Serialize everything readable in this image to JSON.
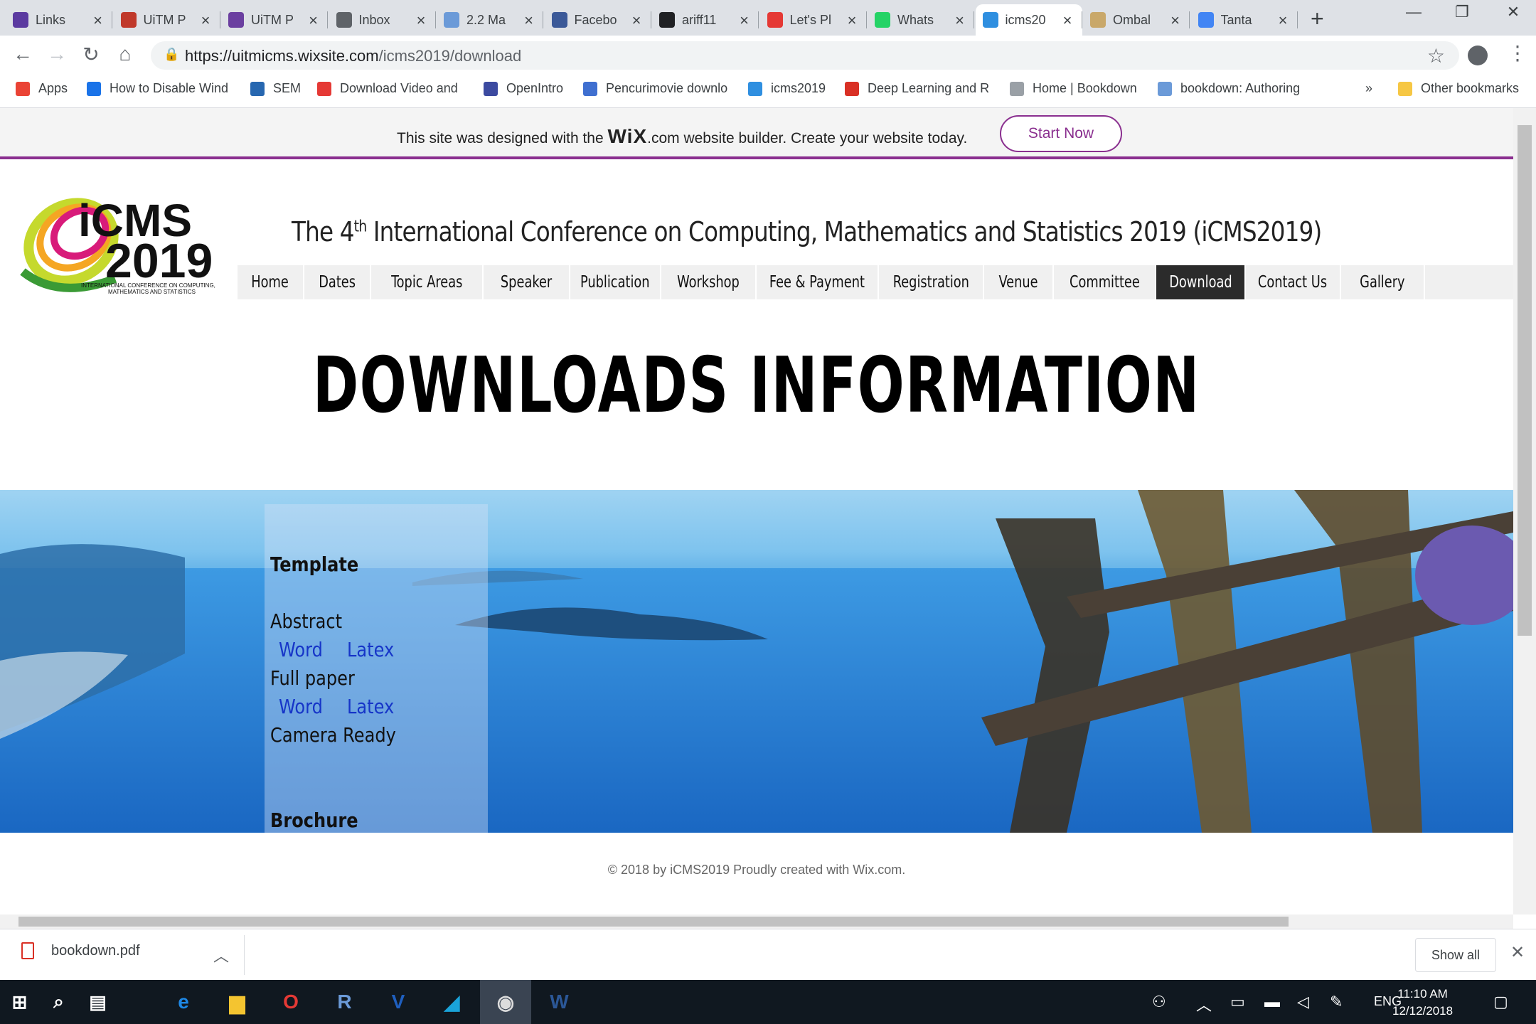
{
  "tabs": [
    {
      "title": "Links",
      "icon": "shield-icon",
      "color": "#5b3aa0"
    },
    {
      "title": "UiTM P",
      "icon": "uitm-icon",
      "color": "#c0392b"
    },
    {
      "title": "UiTM P",
      "icon": "crest-icon",
      "color": "#6b3fa0"
    },
    {
      "title": "Inbox",
      "icon": "mail-icon",
      "color": "#5f6368"
    },
    {
      "title": "2.2 Ma",
      "icon": "r-icon",
      "color": "#6b9ad8"
    },
    {
      "title": "Facebo",
      "icon": "facebook-icon",
      "color": "#3b5998"
    },
    {
      "title": "ariff11",
      "icon": "github-icon",
      "color": "#202124"
    },
    {
      "title": "Let's Pl",
      "icon": "x-red-icon",
      "color": "#e53935"
    },
    {
      "title": "Whats",
      "icon": "whatsapp-icon",
      "color": "#25d366"
    },
    {
      "title": "icms20",
      "icon": "icms-icon",
      "color": "#2f8fe0",
      "active": true
    },
    {
      "title": "Ombal",
      "icon": "sun-icon",
      "color": "#c9a86a"
    },
    {
      "title": "Tanta",
      "icon": "dot-icon",
      "color": "#4285f4"
    }
  ],
  "address": {
    "domain": "https://uitmicms.wixsite.com",
    "path": "/icms2019/download"
  },
  "bookmarks": [
    {
      "label": "Apps",
      "icon": "apps-grid-icon",
      "color": "#ea4335"
    },
    {
      "label": "How to Disable Wind",
      "icon": "link-icon",
      "color": "#1a73e8"
    },
    {
      "label": "SEM",
      "icon": "r-icon",
      "color": "#2767b0"
    },
    {
      "label": "Download Video and",
      "icon": "download-icon",
      "color": "#e53935"
    },
    {
      "label": "OpenIntro",
      "icon": "openintro-icon",
      "color": "#3c4aa0"
    },
    {
      "label": "Pencurimovie downlo",
      "icon": "doc-icon",
      "color": "#3f6fd0"
    },
    {
      "label": "icms2019",
      "icon": "icms-icon",
      "color": "#2f8fe0"
    },
    {
      "label": "Deep Learning and R",
      "icon": "record-icon",
      "color": "#d93025"
    },
    {
      "label": "Home | Bookdown",
      "icon": "page-icon",
      "color": "#9aa0a6"
    },
    {
      "label": "bookdown: Authoring",
      "icon": "r-icon",
      "color": "#6b9ad8"
    }
  ],
  "bookmarks_more": "»",
  "other_bookmarks": "Other bookmarks",
  "wix": {
    "text_before": "This site was designed with the ",
    "brand": "WiX",
    "text_after": ".com website builder. Create your website today.",
    "button": "Start Now",
    "accent": "#8a2f8f"
  },
  "site": {
    "logo_text": "iCMS",
    "logo_year": "2019",
    "logo_sub1": "INTERNATIONAL CONFERENCE ON COMPUTING,",
    "logo_sub2": "MATHEMATICS AND STATISTICS",
    "title_prefix": "The 4",
    "title_sup": "th",
    "title_rest": "  International Conference on Computing, Mathematics and Statistics 2019 (iCMS2019)",
    "nav": [
      "Home",
      "Dates",
      "Topic Areas",
      "Speaker",
      "Publication",
      "Workshop",
      "Fee & Payment",
      "Registration",
      "Venue",
      "Committee",
      "Download",
      "Contact Us",
      "Gallery"
    ],
    "nav_active": "Download",
    "heading": "DOWNLOADS INFORMATION",
    "panel": {
      "template_heading": "Template",
      "abstract": "Abstract",
      "abstract_word": "Word",
      "abstract_latex": "Latex",
      "fullpaper": "Full paper",
      "fullpaper_word": "Word",
      "fullpaper_latex": "Latex",
      "camera_ready": "Camera Ready",
      "brochure": "Brochure"
    },
    "footer": "© 2018 by iCMS2019 Proudly created with Wix.com."
  },
  "download_shelf": {
    "file": "bookdown.pdf",
    "show_all": "Show all"
  },
  "taskbar": {
    "apps": [
      {
        "name": "windows-start-icon"
      },
      {
        "name": "search-icon"
      },
      {
        "name": "task-view-icon"
      },
      {
        "name": "edge-icon"
      },
      {
        "name": "file-explorer-icon"
      },
      {
        "name": "opera-icon"
      },
      {
        "name": "r-icon"
      },
      {
        "name": "v-app-icon"
      },
      {
        "name": "sheet-app-icon"
      },
      {
        "name": "chrome-icon"
      },
      {
        "name": "word-icon"
      }
    ],
    "lang": "ENG",
    "time": "11:10 AM",
    "date": "12/12/2018"
  }
}
